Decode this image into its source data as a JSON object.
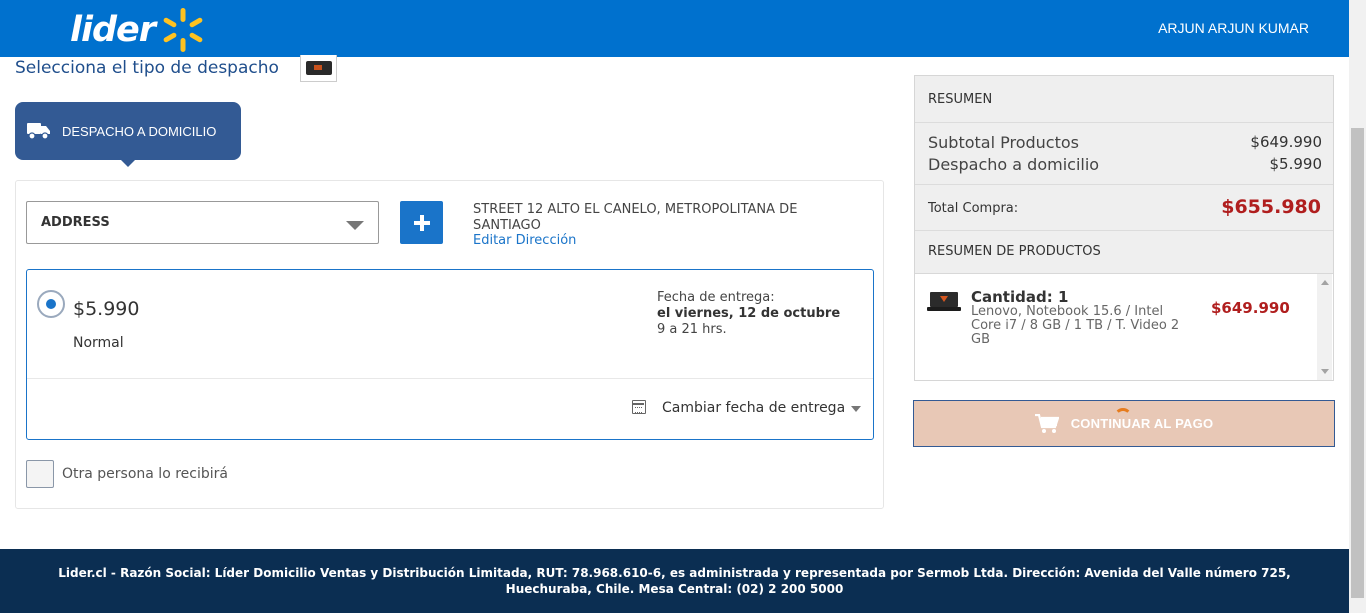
{
  "header": {
    "logo_text": "lider",
    "user_name": "ARJUN  ARJUN KUMAR"
  },
  "page": {
    "title": "Selecciona el tipo de despacho"
  },
  "delivery_tab": {
    "label": "DESPACHO A DOMICILIO",
    "icon": "truck-icon"
  },
  "address": {
    "select_value": "ADDRESS",
    "full_address": "STREET 12 ALTO EL CANELO, METROPOLITANA DE SANTIAGO",
    "edit_link": "Editar Dirección"
  },
  "shipping_option": {
    "selected": true,
    "price": "$5.990",
    "type": "Normal",
    "date_label": "Fecha de entrega:",
    "date_value": "el viernes, 12 de octubre",
    "hours": "9 a 21 hrs.",
    "change_date_label": "Cambiar fecha de entrega"
  },
  "other_person": {
    "checked": false,
    "label": "Otra persona lo recibirá"
  },
  "summary": {
    "heading": "RESUMEN",
    "subtotal_label": "Subtotal Productos",
    "subtotal_value": "$649.990",
    "shipping_label": "Despacho a domicilio",
    "shipping_value": "$5.990",
    "total_label": "Total Compra:",
    "total_value": "$655.980",
    "products_heading": "RESUMEN DE PRODUCTOS",
    "products": [
      {
        "quantity": "Cantidad: 1",
        "description": "Lenovo, Notebook 15.6 / Intel Core i7 / 8 GB / 1 TB / T. Video 2 GB",
        "price": "$649.990"
      }
    ]
  },
  "continue_button": {
    "label": "CONTINUAR AL PAGO",
    "icon": "cart-icon"
  },
  "footer": {
    "text": "Lider.cl - Razón Social: Líder Domicilio Ventas y Distribución Limitada, RUT: 78.968.610-6, es administrada y representada por Sermob Ltda. Dirección: Avenida del Valle número 725, Huechuraba, Chile. Mesa Central: (02) 2 200 5000"
  },
  "colors": {
    "header_blue": "#0071ce",
    "tab_blue": "#335a94",
    "link_blue": "#1a74c9",
    "price_red": "#b01e1e",
    "footer_navy": "#0b2e52",
    "logo_spark_yellow": "#ffc220"
  }
}
